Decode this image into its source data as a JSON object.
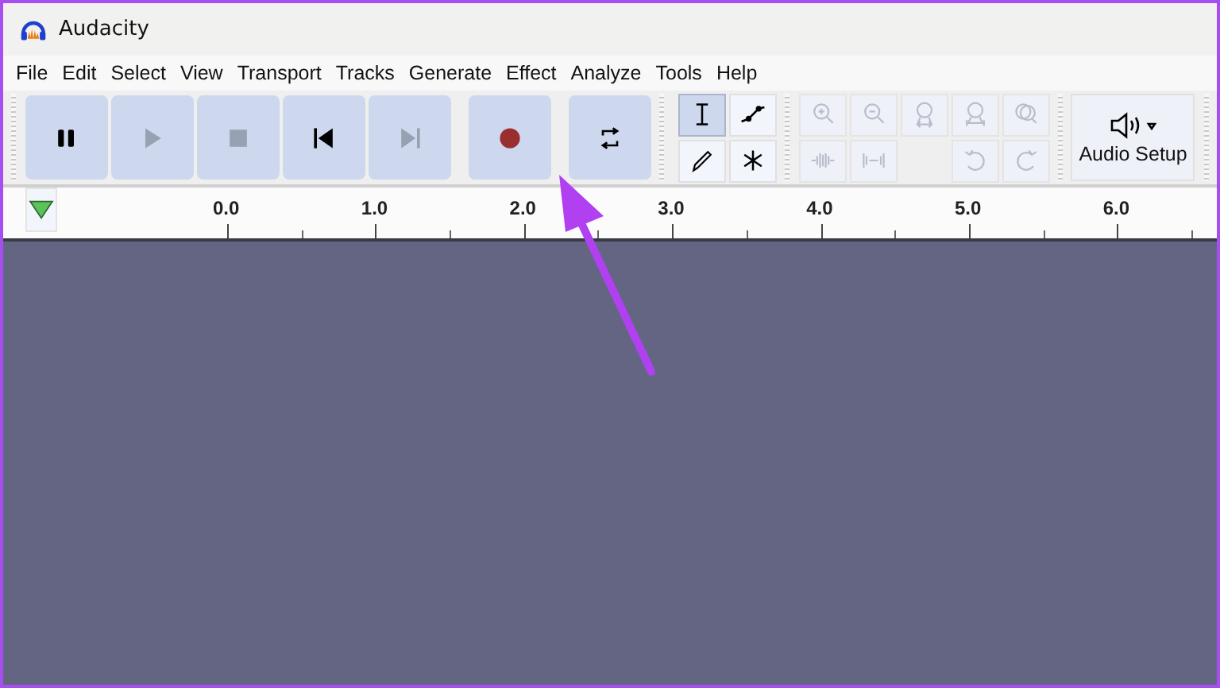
{
  "window": {
    "title": "Audacity"
  },
  "menu": [
    "File",
    "Edit",
    "Select",
    "View",
    "Transport",
    "Tracks",
    "Generate",
    "Effect",
    "Analyze",
    "Tools",
    "Help"
  ],
  "transport": [
    {
      "kind": "pause",
      "disabled": false
    },
    {
      "kind": "play",
      "disabled": true
    },
    {
      "kind": "stop",
      "disabled": true
    },
    {
      "kind": "skip-start",
      "disabled": false
    },
    {
      "kind": "skip-end",
      "disabled": true
    },
    {
      "kind": "record",
      "disabled": false
    },
    {
      "kind": "loop",
      "disabled": false
    }
  ],
  "tools": [
    {
      "kind": "select",
      "selected": true
    },
    {
      "kind": "envelope",
      "selected": false
    },
    {
      "kind": "draw",
      "selected": false
    },
    {
      "kind": "multi",
      "selected": false
    }
  ],
  "edit_tools": [
    {
      "kind": "zoom-in",
      "disabled": true
    },
    {
      "kind": "zoom-out",
      "disabled": true
    },
    {
      "kind": "fit-selection",
      "disabled": true
    },
    {
      "kind": "fit-project",
      "disabled": true
    },
    {
      "kind": "zoom-toggle",
      "disabled": true
    },
    {
      "kind": "trim",
      "disabled": true
    },
    {
      "kind": "silence",
      "disabled": true
    },
    {
      "kind": "undo",
      "disabled": true
    },
    {
      "kind": "redo",
      "disabled": true
    }
  ],
  "audio_setup": {
    "label": "Audio Setup"
  },
  "ruler": {
    "labels": [
      "0.0",
      "1.0",
      "2.0",
      "3.0",
      "4.0",
      "5.0",
      "6.0"
    ]
  },
  "annotation": {
    "kind": "arrow"
  }
}
